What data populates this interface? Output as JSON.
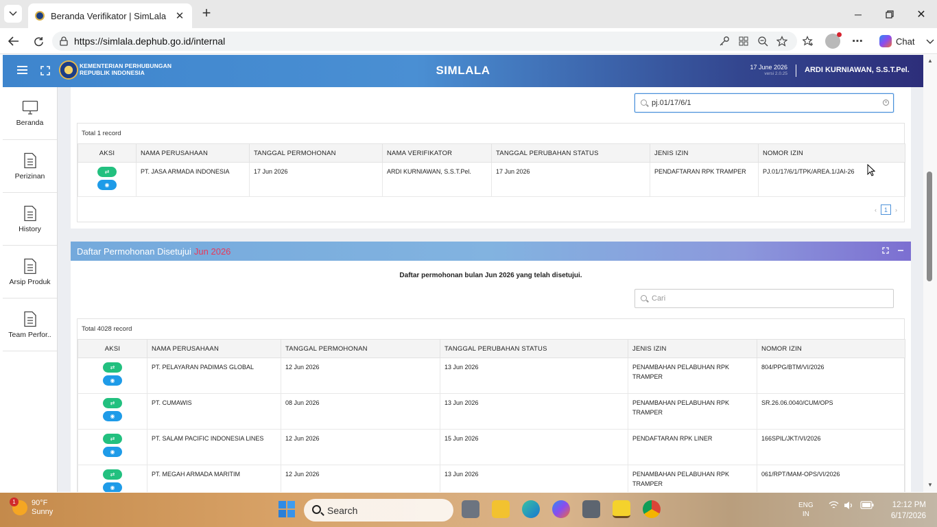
{
  "browser": {
    "tab_title": "Beranda Verifikator | SimLala",
    "url": "https://simlala.dephub.go.id/internal",
    "chat_label": "Chat"
  },
  "header": {
    "ministry_line1": "KEMENTERIAN PERHUBUNGAN",
    "ministry_line2": "REPUBLIK INDONESIA",
    "app_title": "SIMLALA",
    "date": "17 June 2026",
    "version": "versi 2.0.25",
    "user": "ARDI KURNIAWAN, S.S.T.Pel."
  },
  "sidebar": {
    "items": [
      {
        "label": "Beranda",
        "icon": "monitor-icon"
      },
      {
        "label": "Perizinan",
        "icon": "document-icon"
      },
      {
        "label": "History",
        "icon": "document-icon"
      },
      {
        "label": "Arsip Produk",
        "icon": "document-icon"
      },
      {
        "label": "Team Perfor..",
        "icon": "document-icon"
      }
    ]
  },
  "verif_table": {
    "search_value": "pj.01/17/6/1",
    "total": "Total 1 record",
    "columns": [
      "AKSI",
      "NAMA PERUSAHAAN",
      "TANGGAL PERMOHONAN",
      "NAMA VERIFIKATOR",
      "TANGGAL PERUBAHAN STATUS",
      "JENIS IZIN",
      "NOMOR IZIN"
    ],
    "rows": [
      {
        "nama": "PT. JASA ARMADA INDONESIA",
        "tgl_permohonan": "17 Jun 2026",
        "verifikator": "ARDI KURNIAWAN, S.S.T.Pel.",
        "tgl_status": "17 Jun 2026",
        "jenis": "PENDAFTARAN RPK TRAMPER",
        "nomor": "PJ.01/17/6/1/TPK/AREA.1/JAI-26"
      }
    ],
    "pager": {
      "prev": "‹",
      "current": "1",
      "next": "›"
    }
  },
  "approved_panel": {
    "title": "Daftar Permohonan Disetujui",
    "month": "Jun 2026",
    "description": "Daftar permohonan bulan Jun 2026 yang telah disetujui.",
    "search_placeholder": "Cari",
    "total": "Total 4028 record",
    "columns": [
      "AKSI",
      "NAMA PERUSAHAAN",
      "TANGGAL PERMOHONAN",
      "TANGGAL PERUBAHAN STATUS",
      "JENIS IZIN",
      "NOMOR IZIN"
    ],
    "rows": [
      {
        "nama": "PT. PELAYARAN PADIMAS GLOBAL",
        "tgl_permohonan": "12 Jun 2026",
        "tgl_status": "13 Jun 2026",
        "jenis": "PENAMBAHAN PELABUHAN RPK TRAMPER",
        "nomor": "804/PPG/BTM/VI/2026"
      },
      {
        "nama": "PT. CUMAWIS",
        "tgl_permohonan": "08 Jun 2026",
        "tgl_status": "13 Jun 2026",
        "jenis": "PENAMBAHAN PELABUHAN RPK TRAMPER",
        "nomor": "SR.26.06.0040/CUM/OPS"
      },
      {
        "nama": "PT. SALAM PACIFIC INDONESIA LINES",
        "tgl_permohonan": "12 Jun 2026",
        "tgl_status": "15 Jun 2026",
        "jenis": "PENDAFTARAN RPK LINER",
        "nomor": "166SPIL/JKT/VI/2026"
      },
      {
        "nama": "PT. MEGAH ARMADA MARITIM",
        "tgl_permohonan": "12 Jun 2026",
        "tgl_status": "13 Jun 2026",
        "jenis": "PENAMBAHAN PELABUHAN RPK TRAMPER",
        "nomor": "061/RPT/MAM-OPS/VI/2026"
      }
    ]
  },
  "taskbar": {
    "weather_temp": "90°F",
    "weather_desc": "Sunny",
    "weather_badge": "1",
    "search_label": "Search",
    "lang1": "ENG",
    "lang2": "IN",
    "time": "12:12 PM",
    "date": "6/17/2026"
  }
}
